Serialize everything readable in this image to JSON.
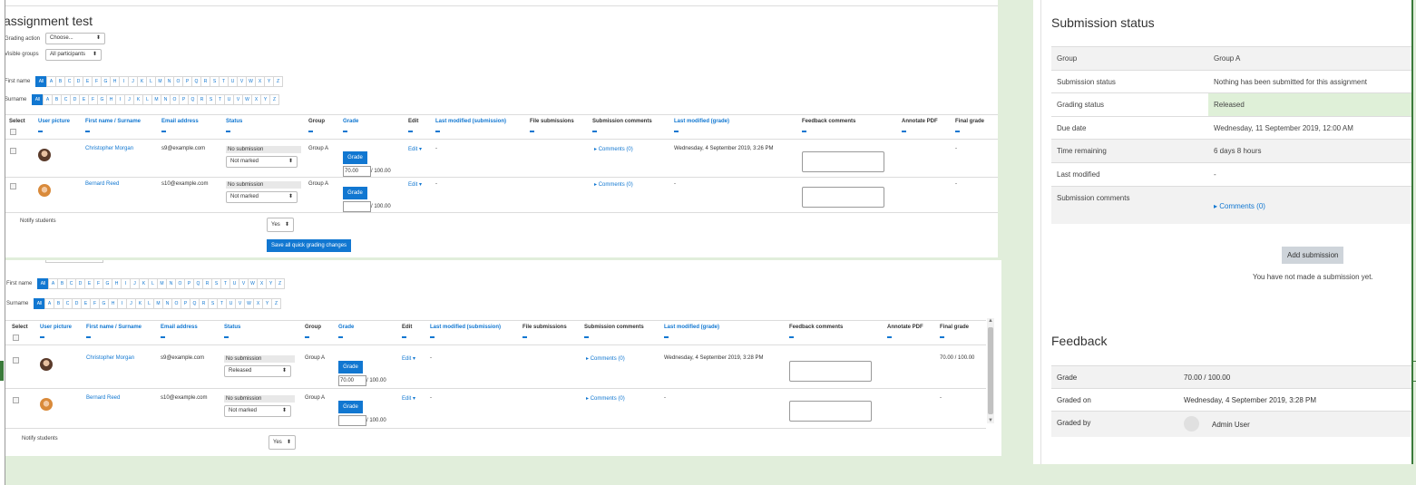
{
  "page_title": "assignment test",
  "grading_action": {
    "label": "Grading action",
    "value": "Choose..."
  },
  "visible_groups": {
    "label": "Visible groups",
    "value": "All participants"
  },
  "first_name_label": "First name",
  "surname_label": "Surname",
  "letters": [
    "All",
    "A",
    "B",
    "C",
    "D",
    "E",
    "F",
    "G",
    "H",
    "I",
    "J",
    "K",
    "L",
    "M",
    "N",
    "O",
    "P",
    "Q",
    "R",
    "S",
    "T",
    "U",
    "V",
    "W",
    "X",
    "Y",
    "Z"
  ],
  "columns": {
    "select": "Select",
    "user_picture": "User picture",
    "name": "First name / Surname",
    "email": "Email address",
    "status": "Status",
    "group": "Group",
    "grade": "Grade",
    "edit": "Edit",
    "last_modified_submission": "Last modified (submission)",
    "file_submissions": "File submissions",
    "submission_comments": "Submission comments",
    "last_modified_grade": "Last modified (grade)",
    "feedback_comments": "Feedback comments",
    "annotate_pdf": "Annotate PDF",
    "final_grade": "Final grade"
  },
  "table1_rows": [
    {
      "name": "Christopher Morgan",
      "email": "s9@example.com",
      "status": "No submission",
      "marking": "Not marked",
      "group": "Group A",
      "grade_btn": "Grade",
      "grade_value": "70.00",
      "grade_max": "/ 100.00",
      "edit": "Edit",
      "last_mod_sub": "-",
      "comments": "Comments (0)",
      "last_mod_grade": "Wednesday, 4 September 2019, 3:26 PM",
      "final_grade": "-"
    },
    {
      "name": "Bernard Reed",
      "email": "s10@example.com",
      "status": "No submission",
      "marking": "Not marked",
      "group": "Group A",
      "grade_btn": "Grade",
      "grade_value": "",
      "grade_max": "/ 100.00",
      "edit": "Edit",
      "last_mod_sub": "-",
      "comments": "Comments (0)",
      "last_mod_grade": "-",
      "final_grade": "-"
    }
  ],
  "table2_rows": [
    {
      "name": "Christopher Morgan",
      "email": "s9@example.com",
      "status": "No submission",
      "marking": "Released",
      "group": "Group A",
      "grade_btn": "Grade",
      "grade_value": "70.00",
      "grade_max": "/ 100.00",
      "edit": "Edit",
      "last_mod_sub": "-",
      "comments": "Comments (0)",
      "last_mod_grade": "Wednesday, 4 September 2019, 3:28 PM",
      "final_grade": "70.00 / 100.00"
    },
    {
      "name": "Bernard Reed",
      "email": "s10@example.com",
      "status": "No submission",
      "marking": "Not marked",
      "group": "Group A",
      "grade_btn": "Grade",
      "grade_value": "",
      "grade_max": "/ 100.00",
      "edit": "Edit",
      "last_mod_sub": "-",
      "comments": "Comments (0)",
      "last_mod_grade": "-",
      "final_grade": "-"
    }
  ],
  "notify_students": {
    "label": "Notify students",
    "value": "Yes"
  },
  "save_button": "Save all quick grading changes",
  "submission_status": {
    "heading": "Submission status",
    "rows": [
      {
        "k": "Group",
        "v": "Group A"
      },
      {
        "k": "Submission status",
        "v": "Nothing has been submitted for this assignment"
      },
      {
        "k": "Grading status",
        "v": "Released"
      },
      {
        "k": "Due date",
        "v": "Wednesday, 11 September 2019, 12:00 AM"
      },
      {
        "k": "Time remaining",
        "v": "6 days 8 hours"
      },
      {
        "k": "Last modified",
        "v": "-"
      },
      {
        "k": "Submission comments",
        "v": "Comments (0)"
      }
    ],
    "add_submission": "Add submission",
    "no_submission_msg": "You have not made a submission yet.",
    "released_color": "#dff0d8"
  },
  "feedback": {
    "heading": "Feedback",
    "grade_label": "Grade",
    "grade_value": "70.00 / 100.00",
    "graded_on_label": "Graded on",
    "graded_on_value": "Wednesday, 4 September 2019, 3:28 PM",
    "graded_by_label": "Graded by",
    "graded_by_value": "Admin User"
  }
}
